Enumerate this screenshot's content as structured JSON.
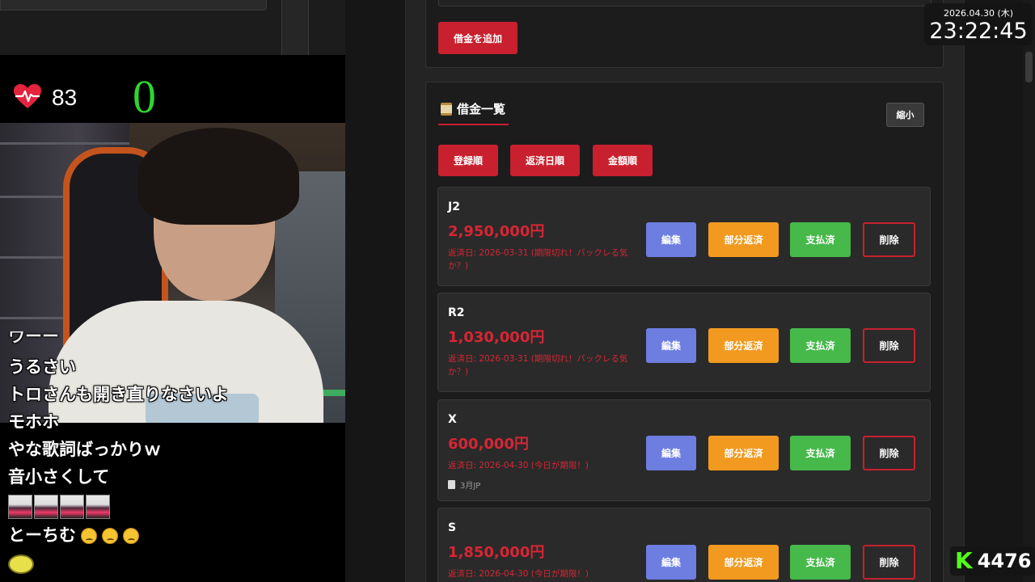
{
  "stream": {
    "heart_rate": "83",
    "counter": "0",
    "chat": [
      "ウーー",
      "うるさい",
      "トロさんも開き直りなさいよ",
      "モホホ",
      "やな歌詞ばっかりｗ",
      "音小さくして",
      "とーちむ"
    ],
    "stamp_count": 4
  },
  "app": {
    "add_button": "借金を追加",
    "list_title": "借金一覧",
    "shrink_button": "縮小",
    "sort_buttons": [
      "登録順",
      "返済日順",
      "金額順"
    ],
    "actions": {
      "edit": "編集",
      "partial": "部分返済",
      "paid": "支払済",
      "delete": "削除"
    },
    "debts": [
      {
        "name": "J2",
        "amount": "2,950,000円",
        "due": "返済日: 2026-03-31 (期限切れ！バックレる気か？)",
        "memo": ""
      },
      {
        "name": "R2",
        "amount": "1,030,000円",
        "due": "返済日: 2026-03-31 (期限切れ！バックレる気か？)",
        "memo": ""
      },
      {
        "name": "X",
        "amount": "600,000円",
        "due": "返済日: 2026-04-30 (今日が期限！)",
        "memo": "3月JP"
      },
      {
        "name": "S",
        "amount": "1,850,000円",
        "due": "返済日: 2026-04-30 (今日が期限！)",
        "memo": ""
      }
    ],
    "colors": {
      "accent_red": "#c8202e",
      "edit": "#6d7ee0",
      "partial": "#f29a1f",
      "paid": "#46b94a"
    }
  },
  "overlay": {
    "date": "2026.04.30 (木)",
    "time": "23:22:45",
    "kick_icon": "K",
    "kick_count": "4476"
  }
}
